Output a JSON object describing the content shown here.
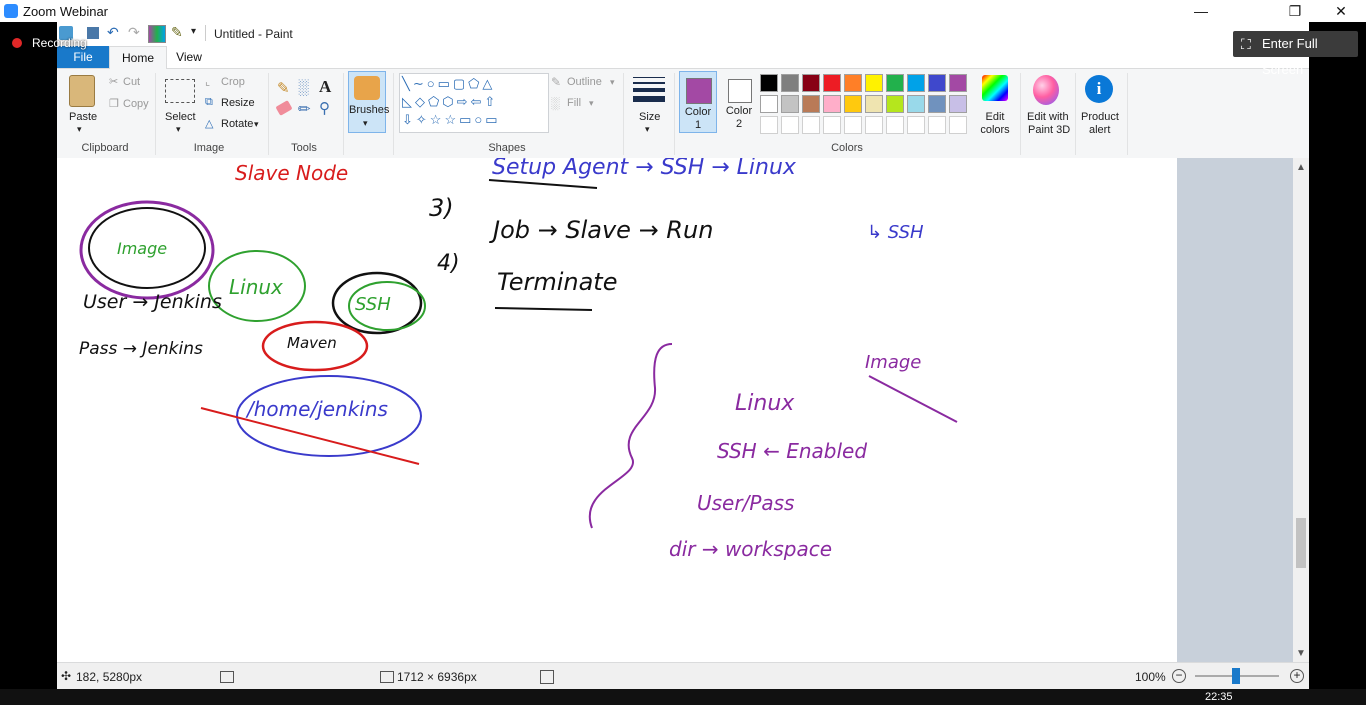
{
  "zoom": {
    "title": "Zoom Webinar",
    "recording_label": "Recording",
    "fullscreen_label": "Enter Full Screen"
  },
  "paint": {
    "title": "Untitled - Paint",
    "tabs": [
      "File",
      "Home",
      "View"
    ],
    "clipboard": {
      "paste": "Paste",
      "cut": "Cut",
      "copy": "Copy",
      "label": "Clipboard"
    },
    "image": {
      "select": "Select",
      "crop": "Crop",
      "resize": "Resize",
      "rotate": "Rotate",
      "label": "Image"
    },
    "tools": {
      "label": "Tools"
    },
    "brushes": {
      "label": "Brushes"
    },
    "shapes": {
      "outline": "Outline",
      "fill": "Fill",
      "label": "Shapes"
    },
    "size": {
      "label": "Size"
    },
    "colors": {
      "color1": "Color",
      "color1_num": "1",
      "color2": "Color",
      "color2_num": "2",
      "edit": "Edit",
      "edit2": "colors",
      "label": "Colors",
      "row1": [
        "#000000",
        "#7f7f7f",
        "#880015",
        "#ed1c24",
        "#ff7f27",
        "#fff200",
        "#22b14c",
        "#00a2e8",
        "#3f48cc",
        "#a349a4"
      ],
      "row2": [
        "#ffffff",
        "#c3c3c3",
        "#b97a57",
        "#ffaec9",
        "#ffc90e",
        "#efe4b0",
        "#b5e61d",
        "#99d9ea",
        "#7092be",
        "#c8bfe7"
      ],
      "color1_value": "#a349a4",
      "color2_value": "#ffffff"
    },
    "paint3d": {
      "line1": "Edit with",
      "line2": "Paint 3D"
    },
    "alert": {
      "line1": "Product",
      "line2": "alert"
    },
    "status": {
      "cursor_pos": "182, 5280px",
      "image_size": "1712 × 6936px",
      "zoom_level": "100%"
    }
  },
  "taskbar": {
    "time": "22:35"
  },
  "handwriting": {
    "slave_node": "Slave Node",
    "three": "3)",
    "setup_agent": "Setup Agent → SSH → Linux",
    "ssh_sub": "↳ SSH",
    "job_line": "Job → Slave → Run",
    "four": "4)",
    "terminate": "Terminate",
    "image": "Image",
    "linux": "Linux",
    "ssh_circle": "SSH",
    "maven": "Maven",
    "user_jenkins": "User → Jenkins",
    "pass_jenkins": "Pass → Jenkins",
    "home_jenkins": "/home/jenkins",
    "b_linux": "Linux",
    "b_ssh": "SSH ← Enabled",
    "b_user": "User/Pass",
    "b_dir": "dir → workspace",
    "image_x": "Image"
  },
  "colors_theme": {
    "accent": "#1979ca",
    "ink_purple": "#8a2aa0",
    "ink_blue": "#3a3acb",
    "ink_green": "#2fa12f",
    "ink_red": "#d81c1c"
  }
}
